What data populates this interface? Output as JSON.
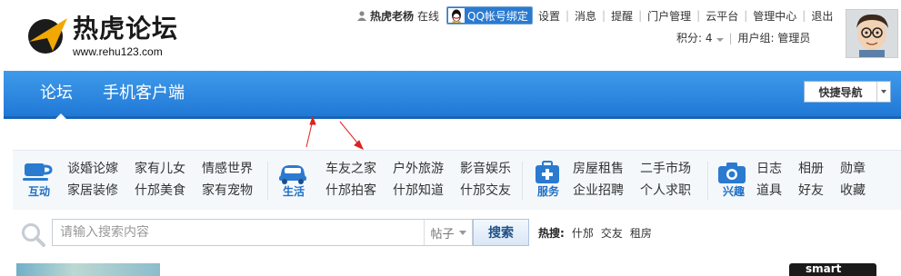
{
  "logo": {
    "title": "热虎论坛",
    "url": "www.rehu123.com"
  },
  "usernav": {
    "username": "热虎老杨",
    "status": "在线",
    "qq_bind": "QQ帐号绑定",
    "links": [
      "设置",
      "消息",
      "提醒",
      "门户管理",
      "云平台",
      "管理中心",
      "退出"
    ]
  },
  "userinfo": {
    "points_label": "积分: 4",
    "usergroup": "用户组: 管理员"
  },
  "nav": {
    "tabs": [
      "论坛",
      "手机客户端"
    ],
    "quick_nav": "快捷导航"
  },
  "categories": [
    {
      "label": "互动",
      "links": [
        "谈婚论嫁",
        "家有儿女",
        "情感世界",
        "家居装修",
        "什邡美食",
        "家有宠物"
      ]
    },
    {
      "label": "生活",
      "links": [
        "车友之家",
        "户外旅游",
        "影音娱乐",
        "什邡拍客",
        "什邡知道",
        "什邡交友"
      ]
    },
    {
      "label": "服务",
      "links": [
        "房屋租售",
        "二手市场",
        "企业招聘",
        "个人求职"
      ]
    },
    {
      "label": "兴趣",
      "links": [
        "日志",
        "相册",
        "勋章",
        "道具",
        "好友",
        "收藏"
      ]
    }
  ],
  "search": {
    "placeholder": "请输入搜索内容",
    "type": "帖子",
    "button": "搜索",
    "hot_label": "热搜:",
    "hot_keywords": [
      "什邡",
      "交友",
      "租房"
    ]
  },
  "bottom": {
    "ad_text": "smart"
  },
  "colors": {
    "nav_blue": "#2a86e0",
    "link_blue": "#1f6fc7",
    "annotation_red": "#e02020"
  }
}
